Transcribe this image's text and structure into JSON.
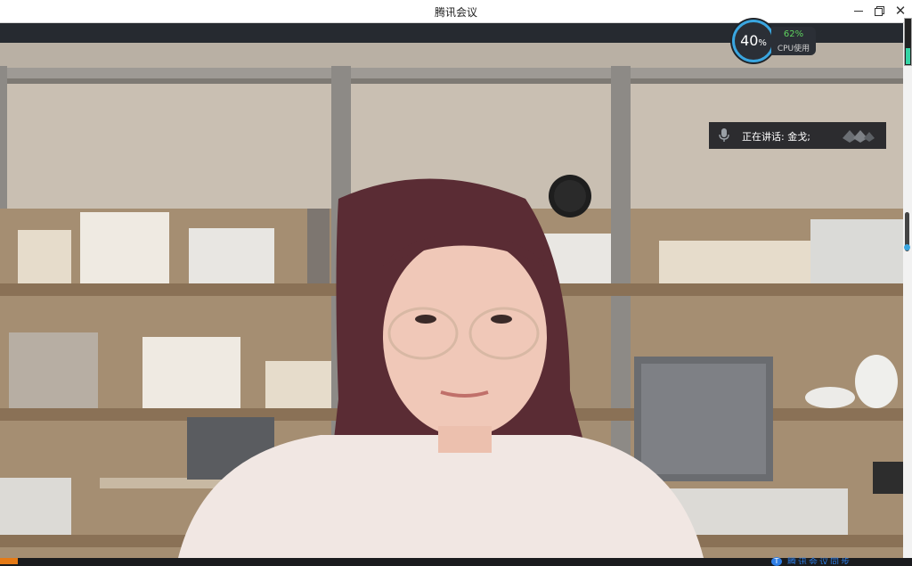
{
  "window": {
    "title": "腾讯会议",
    "min_glyph": "—",
    "restore_glyph": "",
    "close_glyph": "✕"
  },
  "cpu": {
    "app_percent": "40",
    "app_percent_unit": "%",
    "cpu_percent": "62%",
    "cpu_label": "CPU使用"
  },
  "speaking": {
    "label": "正在讲话: 金戈;"
  },
  "bottom": {
    "badge": "T",
    "truncated_text": "腾讯会议同步"
  },
  "colors": {
    "accent_blue": "#3aa6e0",
    "cpu_green": "#5fd35f",
    "volume_green": "#34d4a4",
    "orange_tab": "#e57a16"
  },
  "icons": {
    "mic": "microphone-icon",
    "brand": "tencent-meeting-logo"
  },
  "volume": {
    "mic_level": 0.35,
    "speaker_level": 0.1
  }
}
